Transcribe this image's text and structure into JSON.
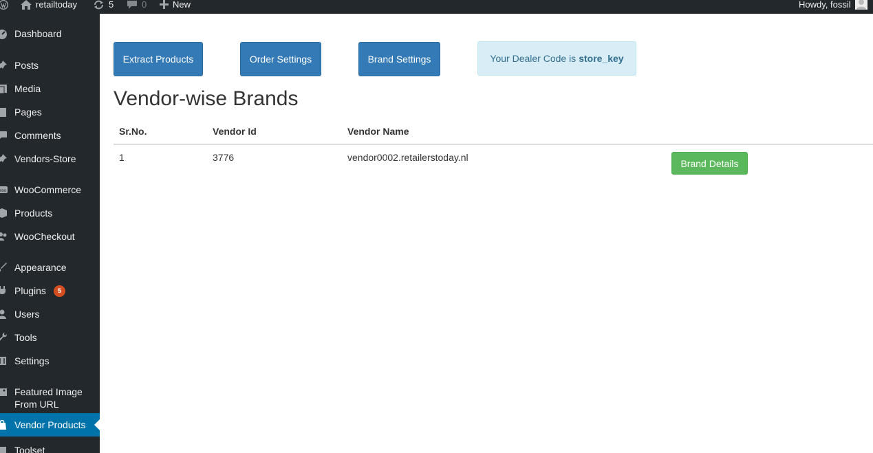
{
  "adminbar": {
    "site_name": "retailtoday",
    "updates_count": "5",
    "comments_count": "0",
    "new_label": "New",
    "greeting": "Howdy, fossil"
  },
  "sidebar": {
    "items": [
      {
        "label": "Dashboard",
        "icon": "dashboard-icon"
      },
      {
        "label": "Posts",
        "icon": "pin-icon"
      },
      {
        "label": "Media",
        "icon": "media-icon"
      },
      {
        "label": "Pages",
        "icon": "page-icon"
      },
      {
        "label": "Comments",
        "icon": "comment-icon"
      },
      {
        "label": "Vendors-Store",
        "icon": "pin-icon"
      },
      {
        "label": "WooCommerce",
        "icon": "woo-icon"
      },
      {
        "label": "Products",
        "icon": "box-icon"
      },
      {
        "label": "WooCheckout",
        "icon": "users-icon"
      },
      {
        "label": "Appearance",
        "icon": "brush-icon"
      },
      {
        "label": "Plugins",
        "icon": "plug-icon",
        "badge": "5"
      },
      {
        "label": "Users",
        "icon": "user-icon"
      },
      {
        "label": "Tools",
        "icon": "wrench-icon"
      },
      {
        "label": "Settings",
        "icon": "sliders-icon"
      },
      {
        "label": "Featured Image From URL",
        "icon": "image-icon"
      },
      {
        "label": "Vendor Products",
        "icon": "bag-icon",
        "current": true
      },
      {
        "label": "Toolset",
        "icon": "toolset-icon"
      }
    ]
  },
  "toolbar": {
    "extract_label": "Extract Products",
    "order_label": "Order Settings",
    "brand_label": "Brand Settings"
  },
  "dealer": {
    "prefix": "Your Dealer Code is",
    "code": "store_key"
  },
  "page": {
    "title": "Vendor-wise Brands"
  },
  "table": {
    "headers": [
      "Sr.No.",
      "Vendor Id",
      "Vendor Name",
      ""
    ],
    "rows": [
      {
        "sr": "1",
        "vendor_id": "3776",
        "vendor_name": "vendor0002.retailerstoday.nl",
        "action_label": "Brand Details"
      }
    ]
  },
  "colors": {
    "primary": "#337ab7",
    "success": "#5cb85c",
    "info_bg": "#d9edf7",
    "admin_bg": "#23282d",
    "current_menu": "#0073aa",
    "badge": "#d54e21"
  }
}
